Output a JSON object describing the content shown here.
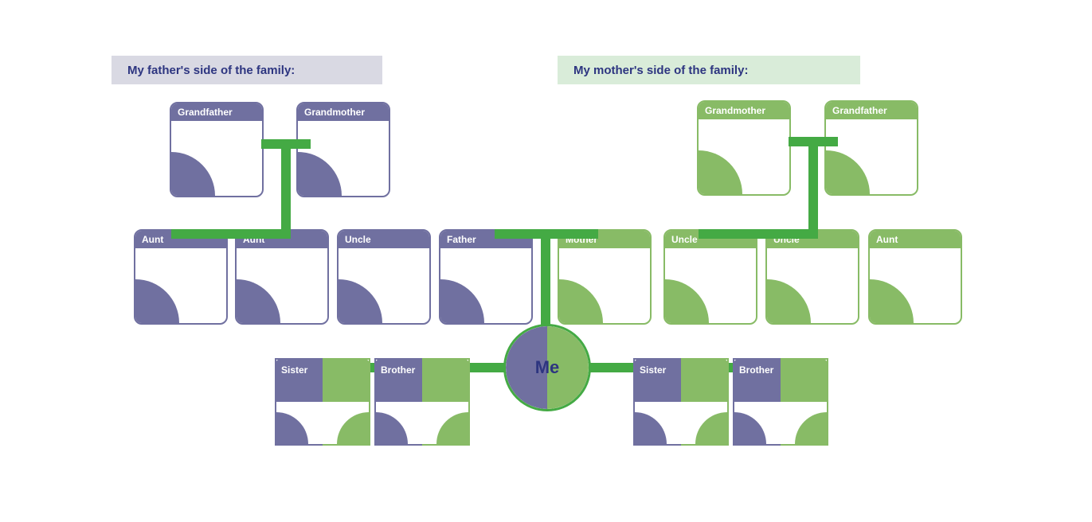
{
  "banners": {
    "father": "My father's side of the family:",
    "mother": "My mother's side of the family:"
  },
  "grandparents": {
    "paternal_grandfather": "Grandfather",
    "paternal_grandmother": "Grandmother",
    "maternal_grandmother": "Grandmother",
    "maternal_grandfather": "Grandfather"
  },
  "parents_gen": {
    "aunt1": "Aunt",
    "aunt2": "Aunt",
    "uncle1": "Uncle",
    "father": "Father",
    "mother": "Mother",
    "uncle2": "Uncle",
    "uncle3": "Uncle",
    "aunt3": "Aunt"
  },
  "siblings": {
    "sister_left": "Sister",
    "brother_left": "Brother",
    "me": "Me",
    "sister_right": "Sister",
    "brother_right": "Brother"
  }
}
